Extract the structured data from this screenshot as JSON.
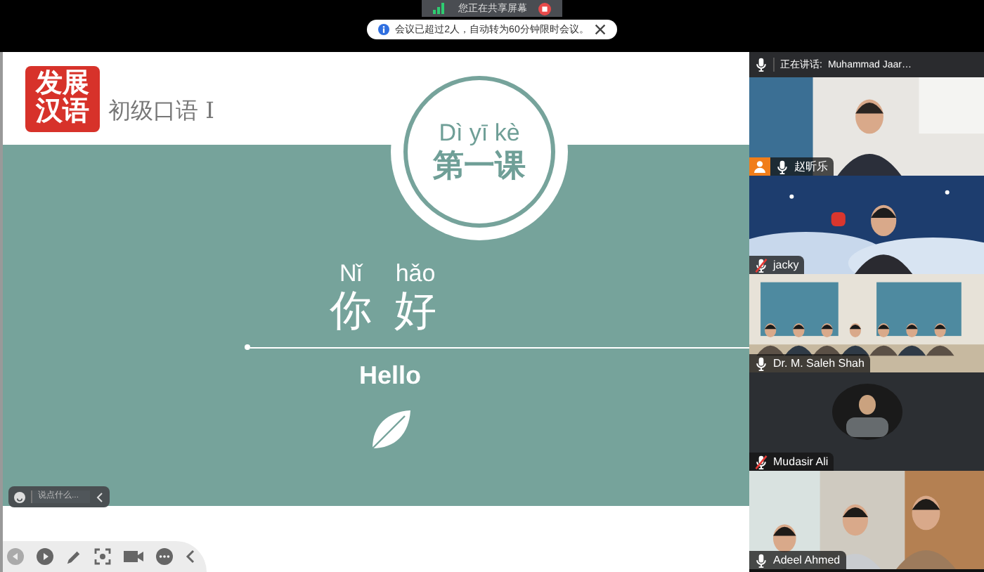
{
  "share_banner": {
    "text": "您正在共享屏幕"
  },
  "notice": {
    "text": "会议已超过2人，自动转为60分钟限时会议。"
  },
  "slide": {
    "logo": [
      "发展",
      "汉语"
    ],
    "course": "初级口语 I",
    "lesson_pinyin": "Dì yī kè",
    "lesson": "第一课",
    "words": [
      {
        "pinyin": "Nǐ",
        "hanzi": "你"
      },
      {
        "pinyin": "hǎo",
        "hanzi": "好"
      }
    ],
    "meaning": "Hello"
  },
  "chat": {
    "placeholder": "说点什么..."
  },
  "speaking": {
    "label": "正在讲话:",
    "name": "Muhammad Jaar…"
  },
  "participants": [
    {
      "name": "赵昕乐",
      "muted": false,
      "host": true,
      "kind": "camera"
    },
    {
      "name": "jacky",
      "muted": true,
      "host": false,
      "kind": "camera"
    },
    {
      "name": "Dr. M. Saleh Shah",
      "muted": false,
      "host": false,
      "kind": "camera"
    },
    {
      "name": "Mudasir Ali",
      "muted": true,
      "host": false,
      "kind": "avatar"
    },
    {
      "name": "Adeel Ahmed",
      "muted": false,
      "host": false,
      "kind": "camera"
    }
  ]
}
